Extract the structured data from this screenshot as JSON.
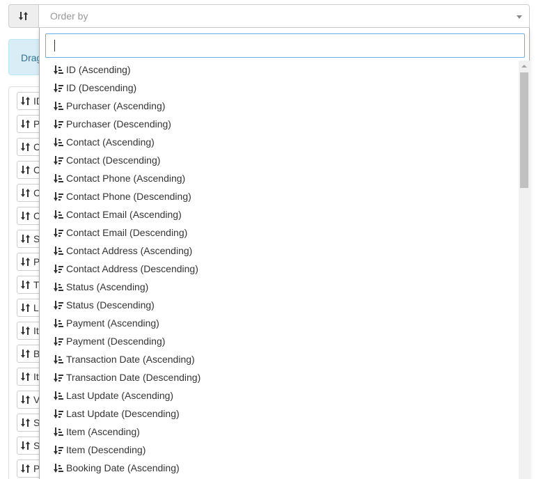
{
  "select": {
    "placeholder": "Order by",
    "addon_icon": "sort-icon"
  },
  "info_panel": {
    "text": "Drag"
  },
  "list": {
    "items": [
      "ID",
      "P",
      "C",
      "C",
      "C",
      "C",
      "S",
      "P",
      "T",
      "L",
      "It",
      "B",
      "It",
      "V",
      "S",
      "S",
      "P"
    ]
  },
  "dropdown": {
    "search_value": "",
    "options": [
      {
        "label": "ID (Ascending)",
        "dir": "asc"
      },
      {
        "label": "ID (Descending)",
        "dir": "desc"
      },
      {
        "label": "Purchaser (Ascending)",
        "dir": "asc"
      },
      {
        "label": "Purchaser (Descending)",
        "dir": "desc"
      },
      {
        "label": "Contact (Ascending)",
        "dir": "asc"
      },
      {
        "label": "Contact (Descending)",
        "dir": "desc"
      },
      {
        "label": "Contact Phone (Ascending)",
        "dir": "asc"
      },
      {
        "label": "Contact Phone (Descending)",
        "dir": "desc"
      },
      {
        "label": "Contact Email (Ascending)",
        "dir": "asc"
      },
      {
        "label": "Contact Email (Descending)",
        "dir": "desc"
      },
      {
        "label": "Contact Address (Ascending)",
        "dir": "asc"
      },
      {
        "label": "Contact Address (Descending)",
        "dir": "desc"
      },
      {
        "label": "Status (Ascending)",
        "dir": "asc"
      },
      {
        "label": "Status (Descending)",
        "dir": "desc"
      },
      {
        "label": "Payment (Ascending)",
        "dir": "asc"
      },
      {
        "label": "Payment (Descending)",
        "dir": "desc"
      },
      {
        "label": "Transaction Date (Ascending)",
        "dir": "asc"
      },
      {
        "label": "Transaction Date (Descending)",
        "dir": "desc"
      },
      {
        "label": "Last Update (Ascending)",
        "dir": "asc"
      },
      {
        "label": "Last Update (Descending)",
        "dir": "desc"
      },
      {
        "label": "Item (Ascending)",
        "dir": "asc"
      },
      {
        "label": "Item (Descending)",
        "dir": "desc"
      },
      {
        "label": "Booking Date (Ascending)",
        "dir": "asc"
      }
    ]
  },
  "colors": {
    "info_bg": "#d9edf7",
    "info_text": "#31708f",
    "focus_border": "#66afe9"
  }
}
